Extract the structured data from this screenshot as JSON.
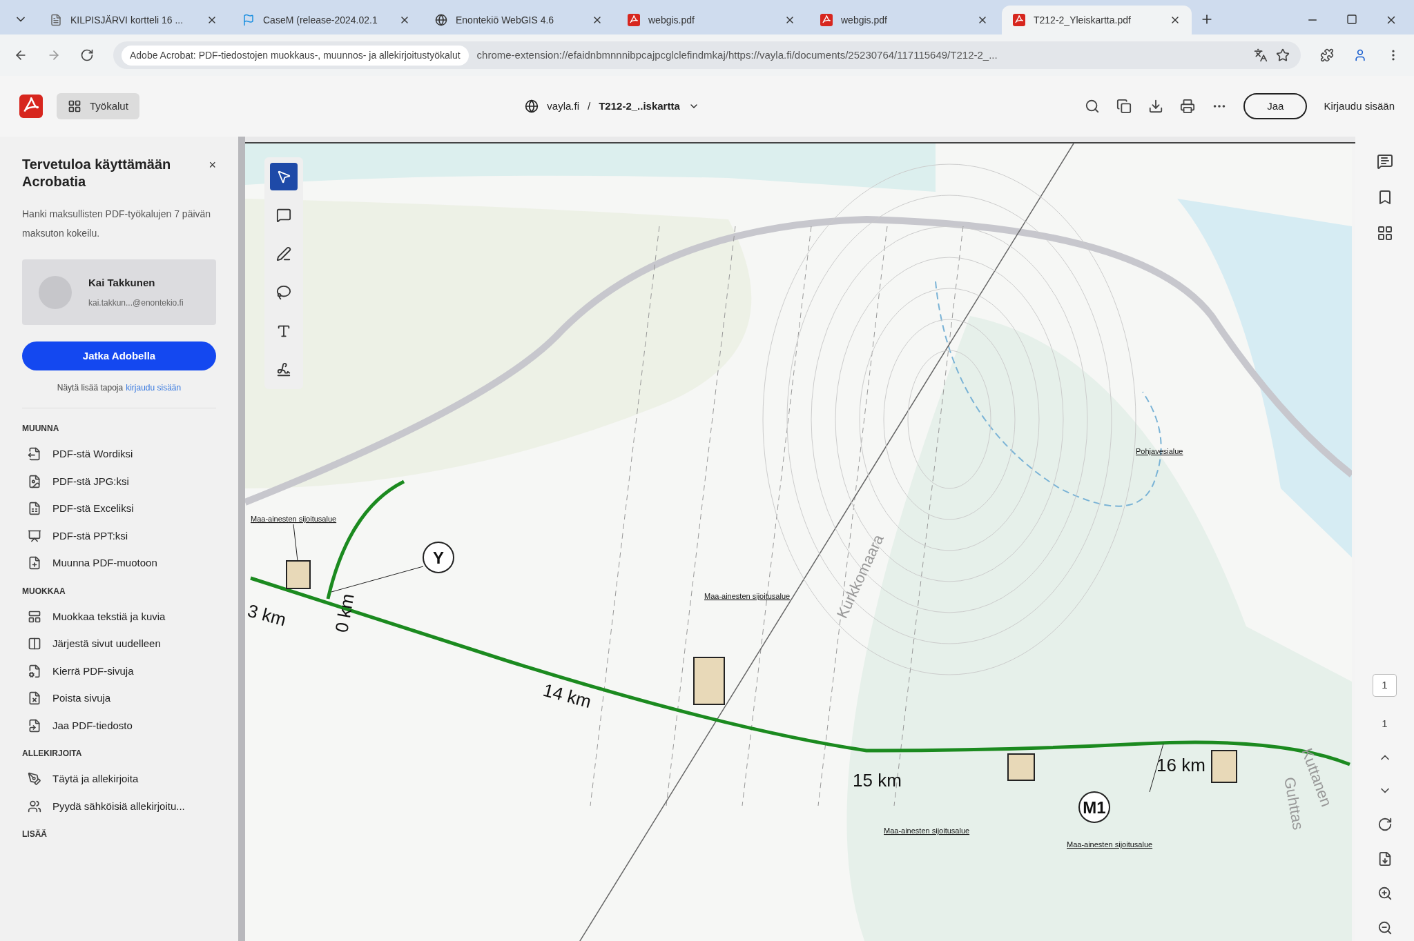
{
  "tabs": [
    {
      "title": "KILPISJÄRVI kortteli 16 ...",
      "selected": false
    },
    {
      "title": "CaseM (release-2024.02.1",
      "selected": false
    },
    {
      "title": "Enontekiö WebGIS 4.6",
      "selected": false
    },
    {
      "title": "webgis.pdf",
      "selected": false
    },
    {
      "title": "webgis.pdf",
      "selected": false
    },
    {
      "title": "T212-2_Yleiskartta.pdf",
      "selected": true
    }
  ],
  "address_bar": {
    "site_label": "Adobe Acrobat: PDF-tiedostojen muokkaus-, muunnos- ja allekirjoitustyökalut",
    "url": "chrome-extension://efaidnbmnnnibpcajpcglclefindmkaj/https://vayla.fi/documents/25230764/117115649/T212-2_..."
  },
  "acrobat_toolbar": {
    "tools_label": "Työkalut",
    "breadcrumb_site": "vayla.fi",
    "breadcrumb_sep": "/",
    "file_name": "T212-2_..iskartta",
    "share_button": "Jaa",
    "sign_in": "Kirjaudu sisään"
  },
  "sidebar": {
    "title": "Tervetuloa käyttämään Acrobatia",
    "close": "×",
    "description": "Hanki maksullisten PDF-työkalujen 7 päivän maksuton kokeilu.",
    "account": {
      "name": "Kai Takkunen",
      "email": "kai.takkun...@enontekio.fi"
    },
    "continue_button": "Jatka Adobella",
    "more_text": "Näytä lisää tapoja",
    "sign_in_link": "kirjaudu sisään",
    "sections": [
      {
        "heading": "MUUNNA",
        "items": [
          "PDF-stä Wordiksi",
          "PDF-stä JPG:ksi",
          "PDF-stä Exceliksi",
          "PDF-stä PPT:ksi",
          "Muunna PDF-muotoon"
        ]
      },
      {
        "heading": "MUOKKAA",
        "items": [
          "Muokkaa tekstiä ja kuvia",
          "Järjestä sivut uudelleen",
          "Kierrä PDF-sivuja",
          "Poista sivuja",
          "Jaa PDF-tiedosto"
        ]
      },
      {
        "heading": "ALLEKIRJOITA",
        "items": [
          "Täytä ja allekirjoita",
          "Pyydä sähköisiä allekirjoitu..."
        ]
      },
      {
        "heading": "LISÄÄ"
      }
    ]
  },
  "annotation_tools": [
    {
      "kind": "select",
      "selected": true
    },
    {
      "kind": "comment",
      "selected": false
    },
    {
      "kind": "draw",
      "selected": false
    },
    {
      "kind": "lasso",
      "selected": false
    },
    {
      "kind": "text",
      "selected": false
    },
    {
      "kind": "sign",
      "selected": false
    }
  ],
  "map": {
    "labels": [
      {
        "kind": "km",
        "text": "3 km"
      },
      {
        "kind": "km",
        "text": "0 km"
      },
      {
        "kind": "km",
        "text": "14 km"
      },
      {
        "kind": "km",
        "text": "15 km"
      },
      {
        "kind": "km",
        "text": "16 km"
      },
      {
        "kind": "circle",
        "text": "Y"
      },
      {
        "kind": "circle",
        "text": "M1"
      },
      {
        "kind": "note",
        "text": "Maa-ainesten sijoitusalue"
      },
      {
        "kind": "note",
        "text": "Maa-ainesten sijoitusalue"
      },
      {
        "kind": "note",
        "text": "Maa-ainesten sijoitusalue"
      },
      {
        "kind": "note",
        "text": "Maa-ainesten sijoitusalue"
      },
      {
        "kind": "note",
        "text": "Pohjavesialue"
      },
      {
        "kind": "place",
        "text": "Kurkkomaara"
      },
      {
        "kind": "place",
        "text": "Kuttanen"
      },
      {
        "kind": "place",
        "text": "Guhttas"
      }
    ]
  },
  "page_nav": {
    "current": "1",
    "total": "1"
  }
}
